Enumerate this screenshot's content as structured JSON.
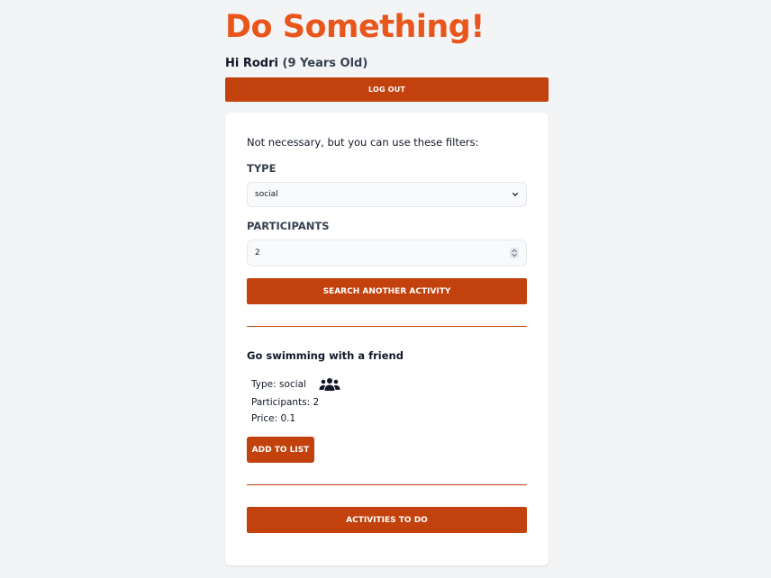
{
  "header": {
    "title": "Do Something!",
    "greeting_prefix": "Hi Rodri",
    "age_text": "(9 Years Old)",
    "logout_label": "LOG OUT"
  },
  "filters": {
    "intro": "Not necessary, but you can use these filters:",
    "type_label": "TYPE",
    "type_value": "social",
    "participants_label": "PARTICIPANTS",
    "participants_value": "2",
    "search_label": "SEARCH ANOTHER ACTIVITY"
  },
  "activity": {
    "title": "Go swimming with a friend",
    "type_text": "Type: social",
    "participants_text": "Participants: 2",
    "price_text": "Price: 0.1",
    "icon": "users-group-icon",
    "add_label": "ADD TO LIST"
  },
  "footer": {
    "todo_label": "ACTIVITIES TO DO"
  },
  "colors": {
    "brand_orange": "#e8561b",
    "button_bg": "#c2410c",
    "page_bg": "#f3f4f6",
    "card_bg": "#ffffff"
  }
}
